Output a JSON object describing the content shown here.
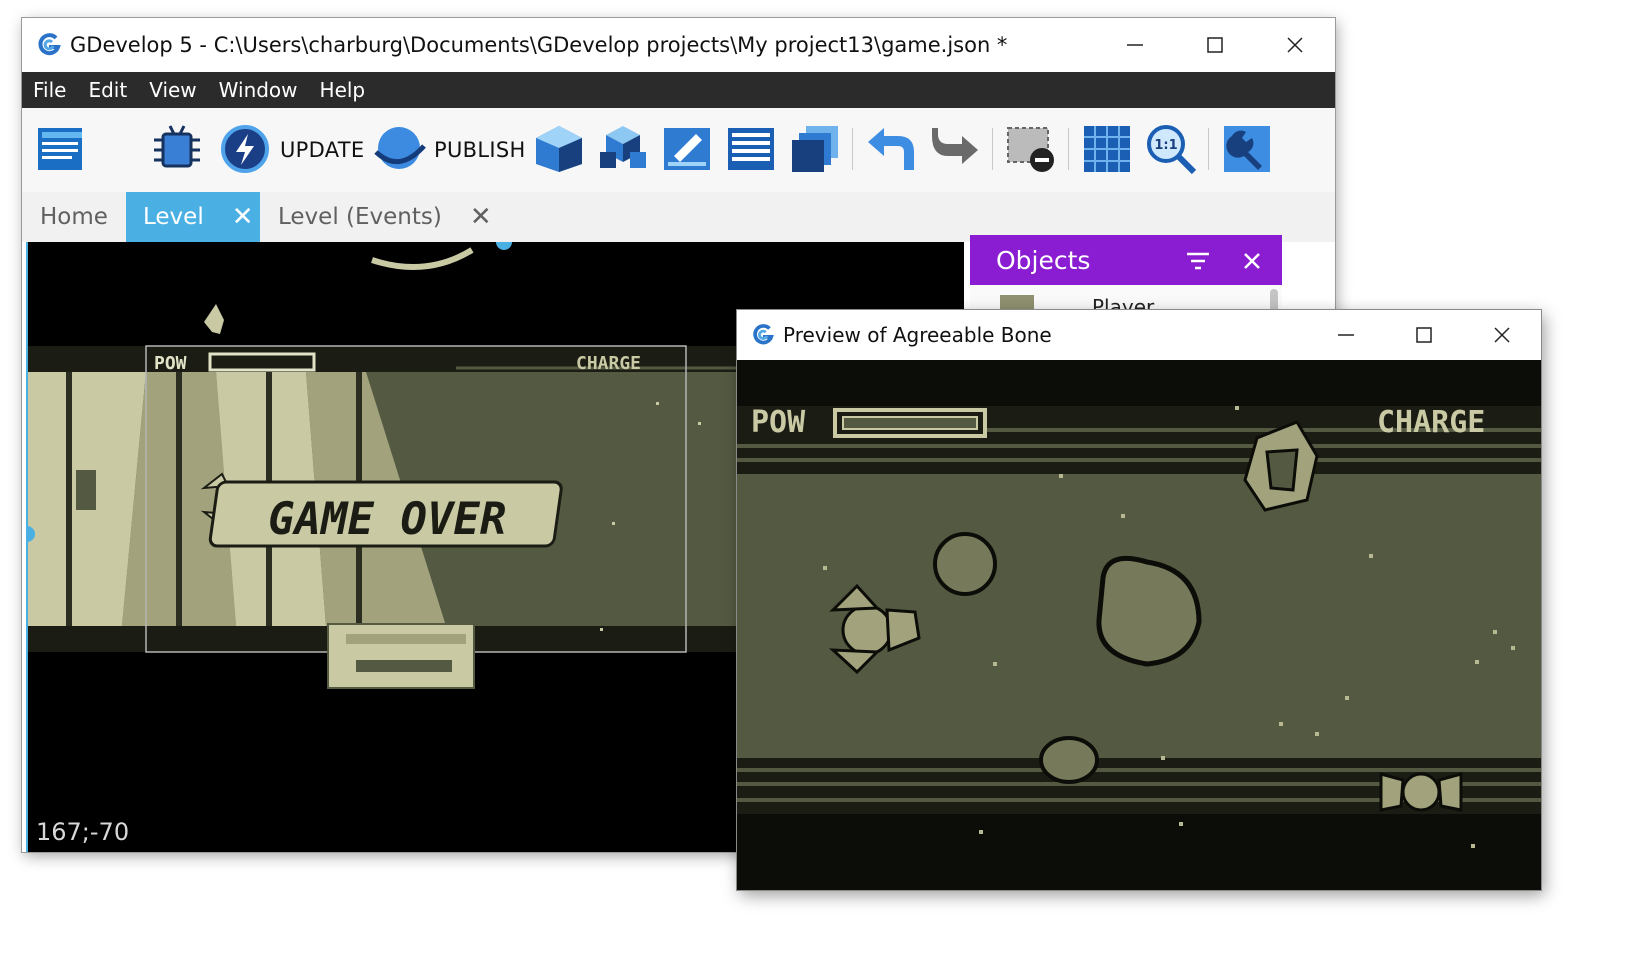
{
  "main_window": {
    "title": "GDevelop 5 - C:\\Users\\charburg\\Documents\\GDevelop projects\\My project13\\game.json *",
    "menu": [
      "File",
      "Edit",
      "View",
      "Window",
      "Help"
    ],
    "toolbar": {
      "update_label": "UPDATE",
      "publish_label": "PUBLISH"
    },
    "tabs": [
      {
        "label": "Home"
      },
      {
        "label": "Level",
        "active": true
      },
      {
        "label": "Level (Events)"
      }
    ],
    "scene": {
      "cursor_coords": "167;-70",
      "hud_pow": "POW",
      "hud_charge": "CHARGE",
      "game_over_text": "GAME OVER"
    },
    "objects_panel": {
      "title": "Objects",
      "first_item": "Player"
    }
  },
  "preview_window": {
    "title": "Preview of Agreeable Bone",
    "hud_pow": "POW",
    "hud_charge": "CHARGE"
  },
  "colors": {
    "menubar": "#2b2b2b",
    "tab_active": "#4ab0e4",
    "objects_header": "#8a1dd1",
    "game_bg": "#545a42",
    "game_light": "#c9c9a4",
    "game_dark": "#0c0d08"
  }
}
